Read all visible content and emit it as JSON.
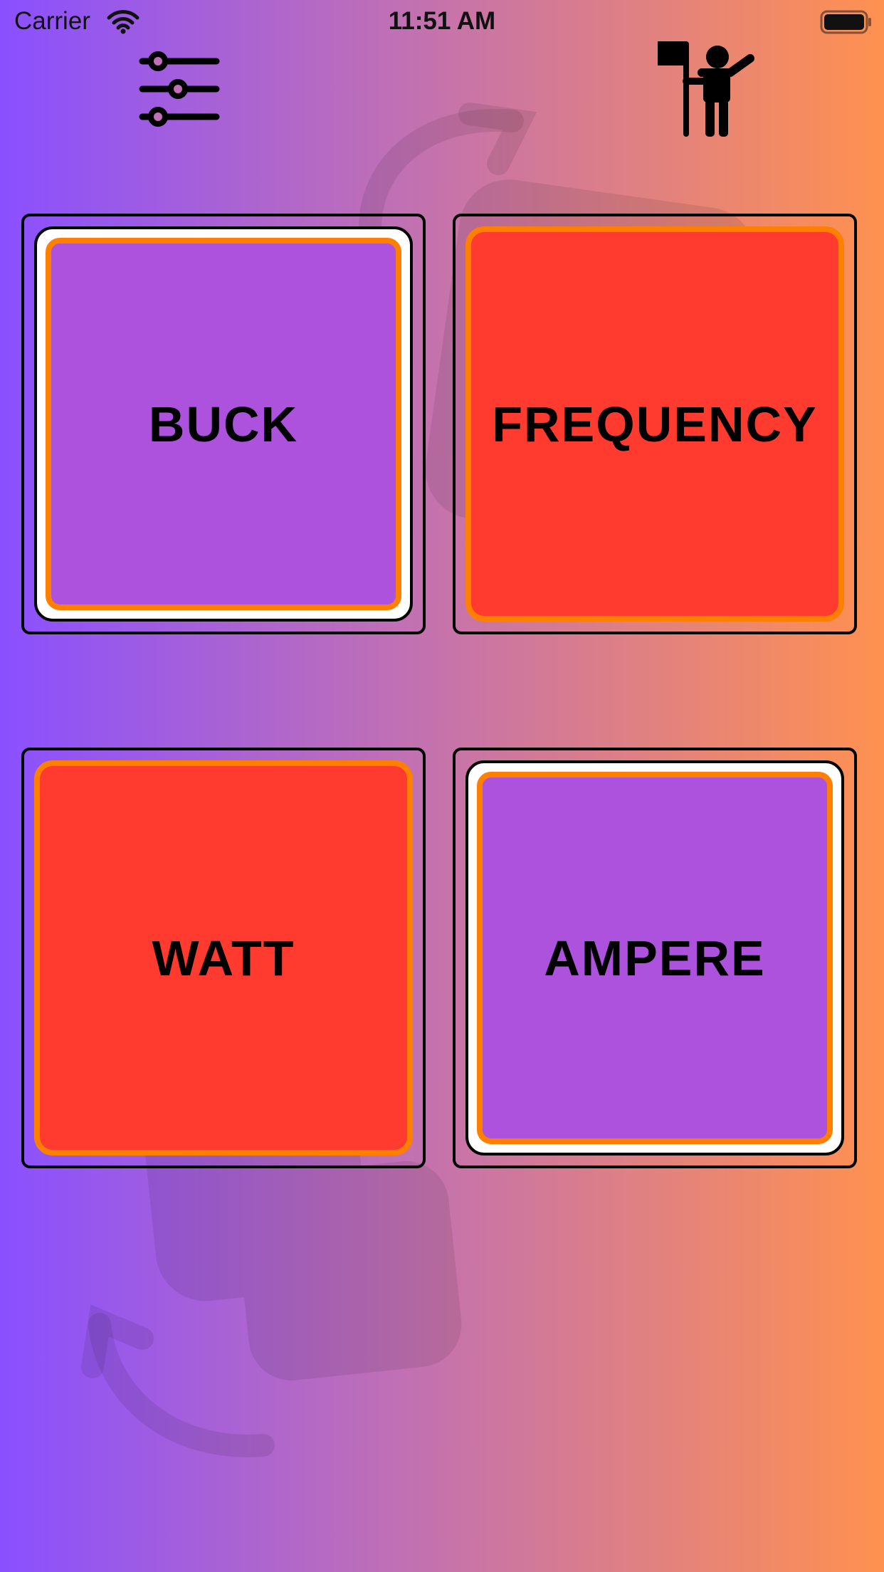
{
  "status_bar": {
    "carrier": "Carrier",
    "time": "11:51 AM",
    "wifi_icon": "wifi-icon",
    "battery_icon": "battery-full-icon"
  },
  "toolbar": {
    "settings_icon": "sliders-icon",
    "guide_icon": "person-with-flag-icon"
  },
  "cards": [
    {
      "label": "BUCK",
      "state": "selected",
      "color": "#ad52dd"
    },
    {
      "label": "FREQUENCY",
      "state": "unselected",
      "color": "#ff3b30"
    },
    {
      "label": "WATT",
      "state": "unselected",
      "color": "#ff3b30"
    },
    {
      "label": "AMPERE",
      "state": "selected",
      "color": "#ad52dd"
    }
  ],
  "colors": {
    "gradient_start": "#8a50ff",
    "gradient_end": "#ff9150",
    "card_purple": "#ad52dd",
    "card_red": "#ff3b30",
    "card_border_orange": "#ff7f00"
  }
}
